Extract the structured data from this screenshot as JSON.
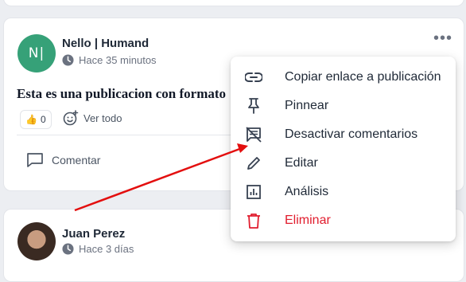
{
  "post": {
    "avatar_initials": "N|",
    "author": "Nello | Humand",
    "time": "Hace 35 minutos",
    "text": "Esta es una publicacion con formato",
    "reaction_emoji": "👍",
    "reaction_count": "0",
    "add_reaction_label": "Ver todo",
    "comment_label": "Comentar"
  },
  "post2": {
    "author": "Juan Perez",
    "time": "Hace 3 días"
  },
  "menu": {
    "items": [
      {
        "label": "Copiar enlace a publicación",
        "icon": "link-icon"
      },
      {
        "label": "Pinnear",
        "icon": "pin-icon"
      },
      {
        "label": "Desactivar comentarios",
        "icon": "comments-off-icon"
      },
      {
        "label": "Editar",
        "icon": "pencil-icon"
      },
      {
        "label": "Análisis",
        "icon": "analytics-icon"
      },
      {
        "label": "Eliminar",
        "icon": "trash-icon"
      }
    ]
  },
  "colors": {
    "accent_avatar": "#36a178",
    "danger": "#e11d2e",
    "arrow": "#e30f0f"
  }
}
